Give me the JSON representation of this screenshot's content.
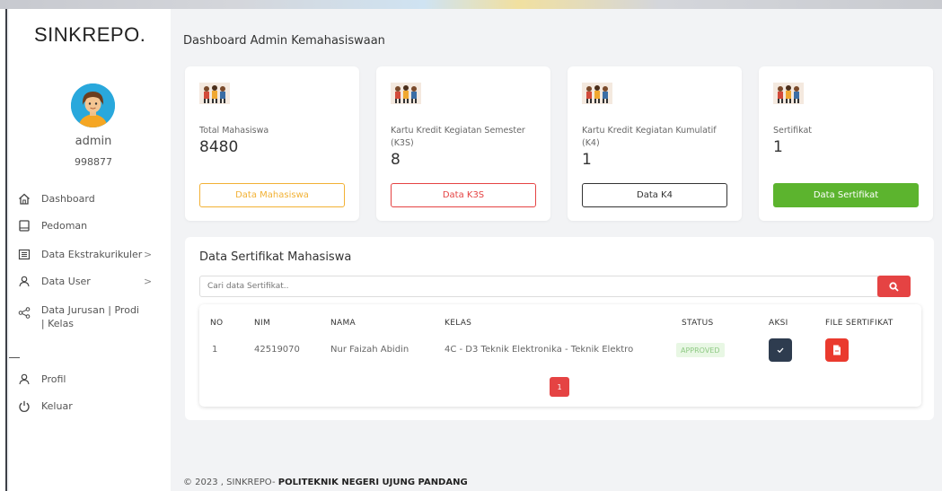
{
  "app": {
    "brand": "SINKREPO."
  },
  "user": {
    "name": "admin",
    "id": "998877"
  },
  "nav": {
    "dashboard": "Dashboard",
    "pedoman": "Pedoman",
    "ekstra": "Data Ekstrakurikuler",
    "user": "Data User",
    "jurusan": "Data Jurusan | Prodi | Kelas",
    "profil": "Profil",
    "keluar": "Keluar",
    "chevron": ">"
  },
  "header": {
    "title": "Dashboard Admin Kemahasiswaan"
  },
  "cards": [
    {
      "label": "Total Mahasiswa",
      "value": "8480",
      "button": "Data Mahasiswa"
    },
    {
      "label": "Kartu Kredit Kegiatan Semester (K3S)",
      "value": "8",
      "button": "Data K3S"
    },
    {
      "label": "Kartu Kredit Kegiatan Kumulatif (K4)",
      "value": "1",
      "button": "Data K4"
    },
    {
      "label": "Sertifikat",
      "value": "1",
      "button": "Data Sertifikat"
    }
  ],
  "panel": {
    "title": "Data Sertifikat Mahasiswa",
    "search_placeholder": "Cari data Sertifikat..",
    "columns": [
      "NO",
      "NIM",
      "NAMA",
      "KELAS",
      "STATUS",
      "AKSI",
      "FILE SERTIFIKAT"
    ],
    "rows": [
      {
        "no": "1",
        "nim": "42519070",
        "nama": "Nur Faizah Abidin",
        "kelas": "4C - D3 Teknik Elektronika - Teknik Elektro",
        "status": "APPROVED"
      }
    ],
    "page": "1"
  },
  "footer": {
    "prefix": "© 2023 , SINKREPO- ",
    "org": "POLITEKNIK NEGERI UJUNG PANDANG"
  },
  "colors": {
    "red": "#e54343",
    "green": "#5cb42e",
    "orange": "#f2b134",
    "dark": "#2e3c4f",
    "sidebar": "#ffffff",
    "background": "#f2f3f5"
  }
}
